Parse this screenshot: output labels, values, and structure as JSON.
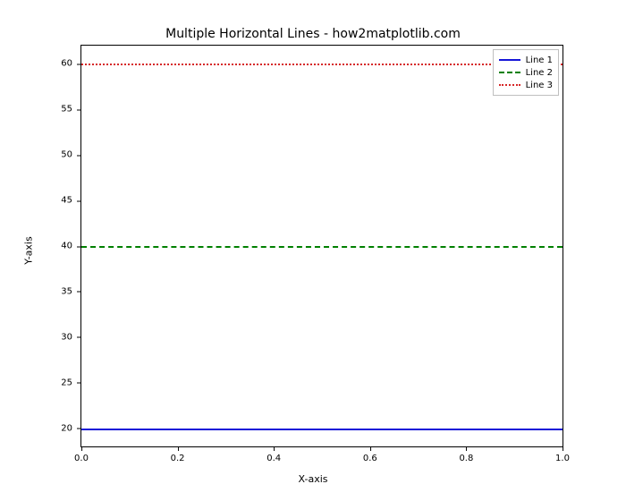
{
  "chart_data": {
    "type": "line",
    "title": "Multiple Horizontal Lines - how2matplotlib.com",
    "xlabel": "X-axis",
    "ylabel": "Y-axis",
    "xlim": [
      0.0,
      1.0
    ],
    "ylim": [
      18,
      62
    ],
    "xticks": [
      "0.0",
      "0.2",
      "0.4",
      "0.6",
      "0.8",
      "1.0"
    ],
    "yticks": [
      "20",
      "25",
      "30",
      "35",
      "40",
      "45",
      "50",
      "55",
      "60"
    ],
    "series": [
      {
        "name": "Line 1",
        "y": 20,
        "style": "solid",
        "color": "#1616d8"
      },
      {
        "name": "Line 2",
        "y": 40,
        "style": "dashed",
        "color": "#008000"
      },
      {
        "name": "Line 3",
        "y": 60,
        "style": "dotted",
        "color": "#d62728"
      }
    ],
    "grid": false,
    "legend_loc": "upper right"
  }
}
